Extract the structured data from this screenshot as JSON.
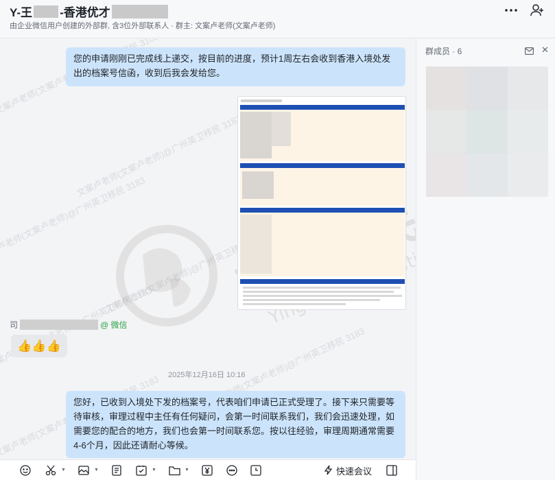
{
  "header": {
    "title_prefix": "Y-王",
    "title_middle": "-香港优才",
    "subtitle": "由企业微信用户创建的外部群, 含3位外部联系人 · 群主: 文案卢老师(文案卢老师)"
  },
  "side_panel": {
    "members_label": "群成员 · 6"
  },
  "messages": {
    "msg1": "您的申请刚刚已完成线上递交，按目前的进度，预计1周左右会收到香港入境处发出的档案号信函，收到后我会发给您。",
    "sender_prefix": "司",
    "sender_suffix": "@ 微信",
    "reaction": "👍👍👍",
    "timestamp": "2025年12月16日 10:16",
    "msg2": "您好，已收到入境处下发的档案号，代表咱们申请已正式受理了。接下来只需要等待审核，审理过程中主任有任何疑问，会第一时间联系我们，我们会迅速处理，如需要您的配合的地方，我们也会第一时间联系您。按以往经验，审理周期通常需要4-6个月，因此还请耐心等候。"
  },
  "watermark": {
    "repeat_text": "文案卢老师(文案卢老师)@广州英卫移民 3183",
    "brand_cn": "英衛移民",
    "brand_en": "Yingwei immigration"
  },
  "toolbar": {
    "quick_meeting_label": "快速会议"
  },
  "colors": {
    "bubble": "#cce4fb",
    "wechat_green": "#2ba245",
    "doc_header_blue": "#1e4fb3",
    "doc_section_bg": "#fdf4e6"
  }
}
